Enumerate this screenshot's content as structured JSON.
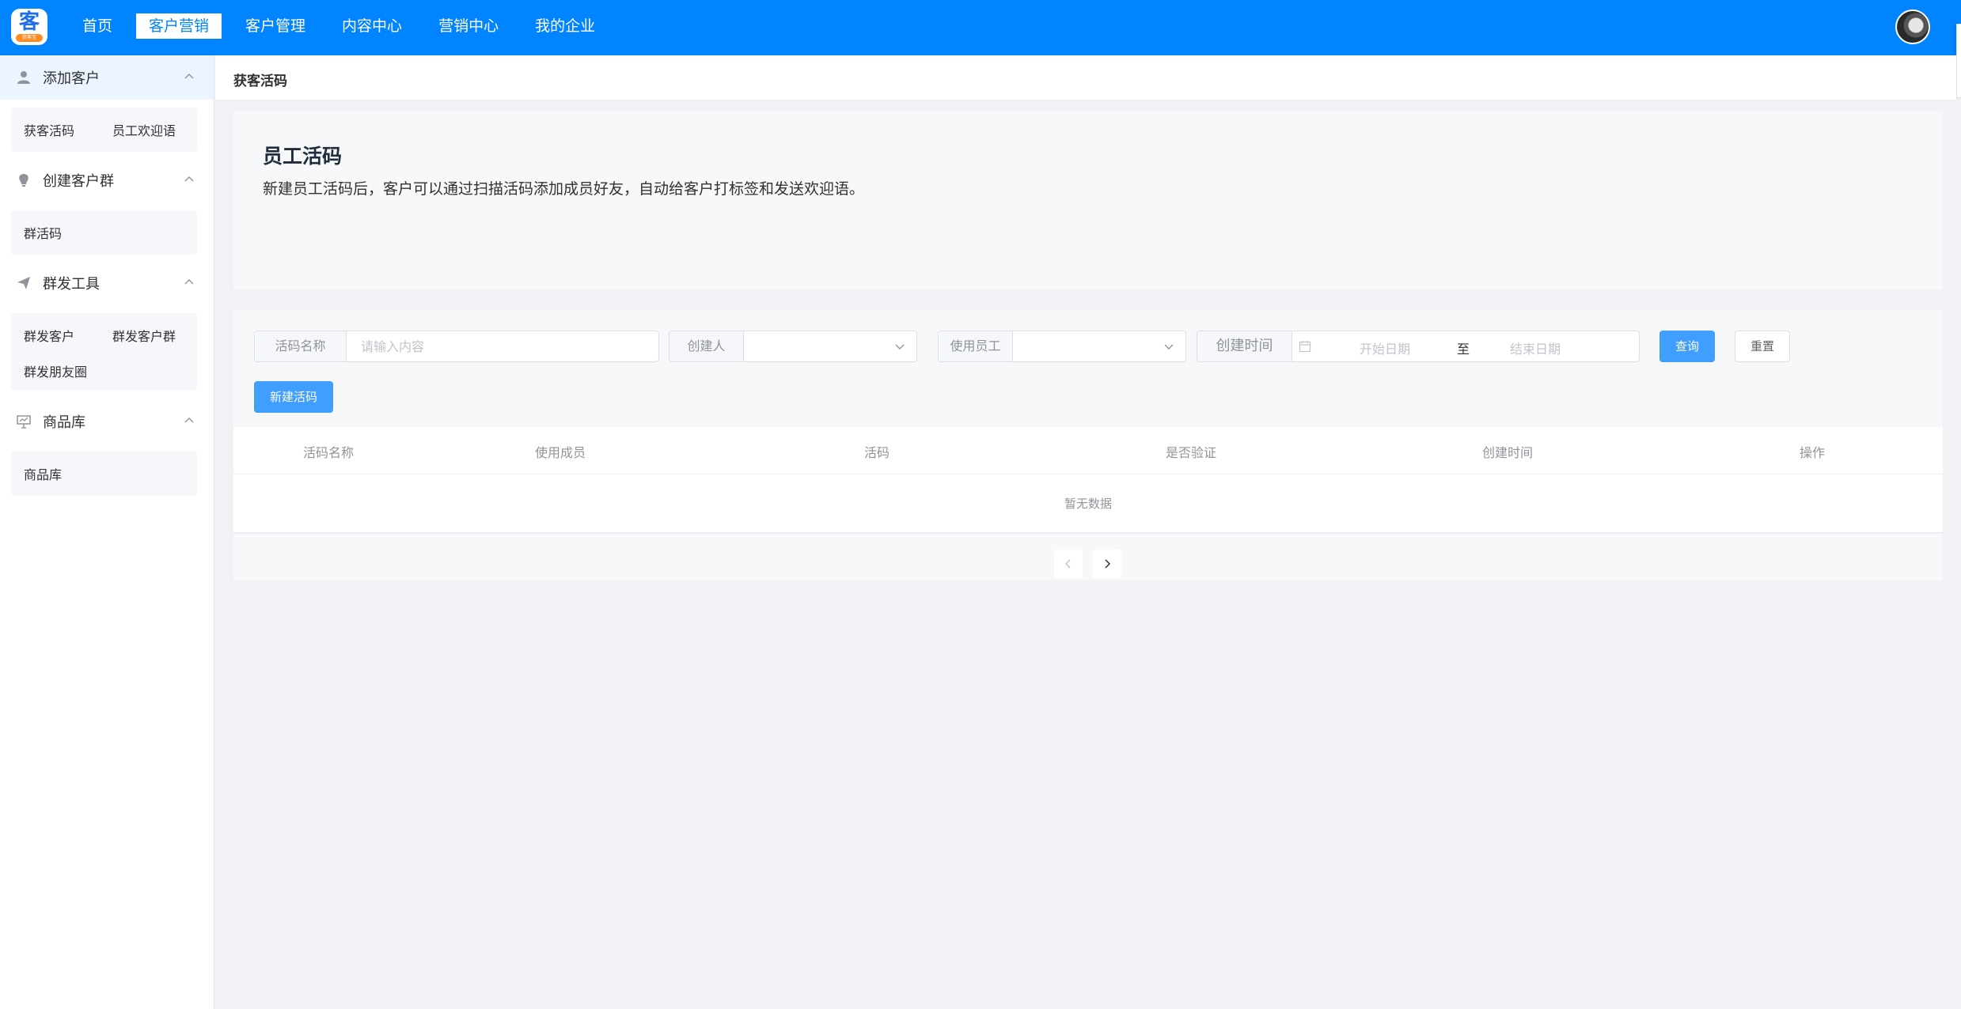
{
  "brand": {
    "logo_glyph": "客",
    "logo_ribbon": "获客宝"
  },
  "topnav": {
    "items": [
      {
        "label": "首页",
        "active": false
      },
      {
        "label": "客户营销",
        "active": true
      },
      {
        "label": "客户管理",
        "active": false
      },
      {
        "label": "内容中心",
        "active": false
      },
      {
        "label": "营销中心",
        "active": false
      },
      {
        "label": "我的企业",
        "active": false
      }
    ]
  },
  "sidebar": {
    "groups": [
      {
        "label": "添加客户",
        "icon": "user-icon",
        "items": [
          "获客活码",
          "员工欢迎语"
        ]
      },
      {
        "label": "创建客户群",
        "icon": "bulb-icon",
        "items": [
          "群活码"
        ]
      },
      {
        "label": "群发工具",
        "icon": "send-icon",
        "items": [
          "群发客户",
          "群发客户群",
          "群发朋友圈"
        ]
      },
      {
        "label": "商品库",
        "icon": "presentation-icon",
        "items": [
          "商品库"
        ]
      }
    ]
  },
  "breadcrumb": "获客活码",
  "intro": {
    "title": "员工活码",
    "description": "新建员工活码后，客户可以通过扫描活码添加成员好友，自动给客户打标签和发送欢迎语。"
  },
  "filters": {
    "name_label": "活码名称",
    "name_placeholder": "请输入内容",
    "name_value": "",
    "creator_label": "创建人",
    "creator_value": "",
    "staff_label": "使用员工",
    "staff_value": "",
    "created_label": "创建时间",
    "start_placeholder": "开始日期",
    "range_separator": "至",
    "end_placeholder": "结束日期",
    "query_button": "查询",
    "reset_button": "重置",
    "new_button": "新建活码"
  },
  "table": {
    "columns": [
      "活码名称",
      "使用成员",
      "活码",
      "是否验证",
      "创建时间",
      "操作"
    ],
    "rows": [],
    "empty_text": "暂无数据"
  },
  "colors": {
    "topbar": "#0084ff",
    "primary_button": "#409eff",
    "page_background": "#f0f2f5"
  }
}
